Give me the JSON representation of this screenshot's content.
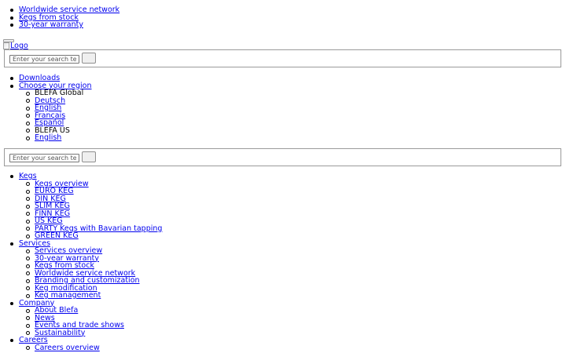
{
  "usp": [
    {
      "label": "Worldwide service network"
    },
    {
      "label": "Kegs from stock"
    },
    {
      "label": "30-year warranty"
    }
  ],
  "header": {
    "logo_alt": "Logo"
  },
  "search": {
    "placeholder": "Enter your search term",
    "button_label": ""
  },
  "meta_nav": {
    "downloads": "Downloads",
    "choose_region": "Choose your region",
    "regions": [
      {
        "name": "BLEFA Global",
        "languages": [
          "Deutsch",
          "English",
          "Français",
          "Español"
        ]
      },
      {
        "name": "BLEFA US",
        "languages": [
          "English"
        ]
      }
    ]
  },
  "main_nav": [
    {
      "label": "Kegs",
      "children": [
        "Kegs overview",
        "EURO KEG",
        "DIN KEG",
        "SLIM KEG",
        "FINN KEG",
        "US KEG",
        "PARTY Kegs with Bavarian tapping",
        "GREEN KEG"
      ]
    },
    {
      "label": "Services",
      "children": [
        "Services overview",
        "30-year warranty",
        "Kegs from stock",
        "Worldwide service network",
        "Branding and customization",
        "Keg modification",
        "Keg management"
      ]
    },
    {
      "label": "Company",
      "children": [
        "About Blefa",
        "News",
        "Events and trade shows",
        "Sustainability"
      ]
    },
    {
      "label": "Careers",
      "children": [
        "Careers overview"
      ]
    }
  ],
  "colors": {
    "link": "#0000ee",
    "text": "#000000",
    "border": "#9a9a9a"
  }
}
